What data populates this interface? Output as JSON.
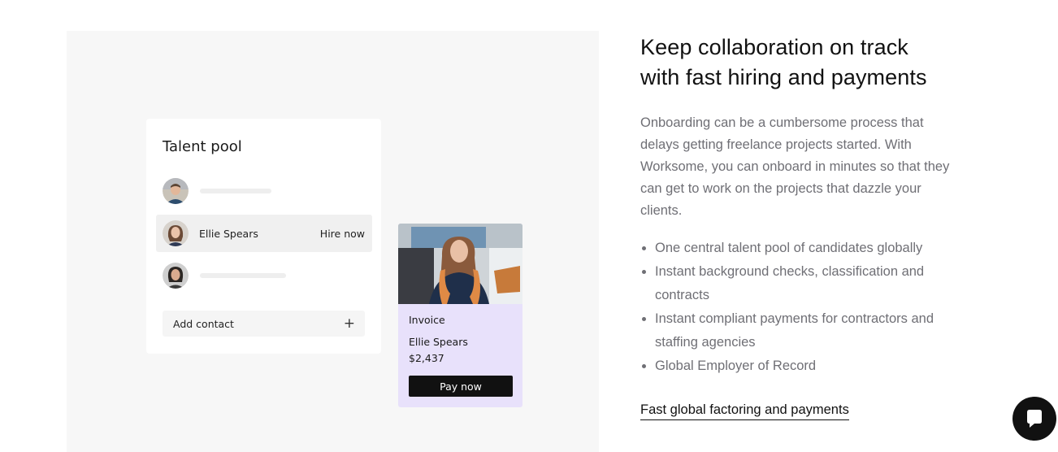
{
  "illustration": {
    "talent_pool": {
      "title": "Talent pool",
      "rows": [
        {
          "name": "",
          "action": ""
        },
        {
          "name": "Ellie Spears",
          "action": "Hire now"
        },
        {
          "name": "",
          "action": ""
        }
      ],
      "add_contact_label": "Add contact",
      "add_icon": "plus-icon"
    },
    "invoice": {
      "label": "Invoice",
      "name": "Ellie Spears",
      "amount": "$2,437",
      "pay_label": "Pay now"
    }
  },
  "content": {
    "headline_line1": "Keep collaboration on track",
    "headline_line2": "with fast hiring and payments",
    "body": "Onboarding can be a cumbersome process that delays getting freelance projects started. With Worksome, you can onboard in minutes so that they can get to work on the projects that dazzle your clients.",
    "bullets": [
      "One central talent pool of candidates globally",
      "Instant background checks, classification and contracts",
      "Instant compliant payments for contractors and staffing agencies",
      "Global Employer of Record"
    ],
    "link_label": "Fast global factoring and payments"
  },
  "chat": {
    "icon": "chat-icon"
  },
  "colors": {
    "panel_bg": "#f7f7f7",
    "invoice_bg": "#e8e1fb",
    "body_text": "#6f6f75",
    "button_bg": "#111111"
  }
}
